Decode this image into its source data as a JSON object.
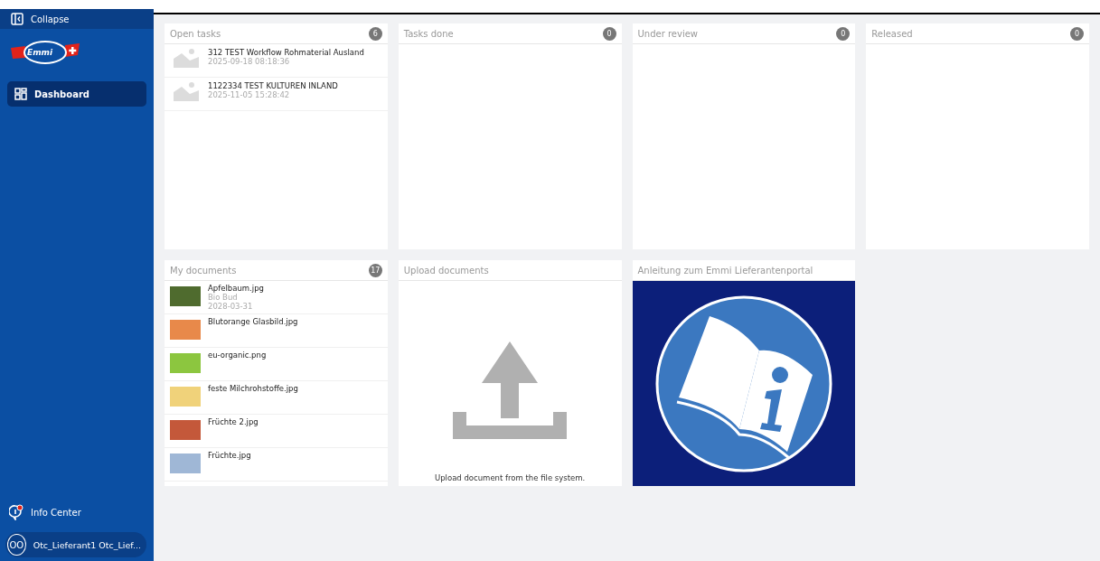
{
  "sidebar": {
    "collapse": "Collapse",
    "logo": "Emmi",
    "items": [
      {
        "label": "Dashboard",
        "selected": true
      }
    ],
    "info_center": {
      "label": "Info Center",
      "notification": true
    },
    "user": {
      "initials": "OO",
      "name": "Otc_Lieferant1 Otc_Lief..."
    }
  },
  "task_columns": [
    {
      "title": "Open tasks",
      "count": "6",
      "items": [
        {
          "title": "312 TEST Workflow Rohmaterial Ausland",
          "date": "2025-09-18 08:18:36"
        },
        {
          "title": "1122334 TEST KULTUREN INLAND",
          "date": "2025-11-05 15:28:42"
        }
      ]
    },
    {
      "title": "Tasks done",
      "count": "0"
    },
    {
      "title": "Under review",
      "count": "0"
    },
    {
      "title": "Released",
      "count": "0"
    }
  ],
  "my_documents": {
    "title": "My documents",
    "count": "17",
    "items": [
      {
        "name": "Apfelbaum.jpg",
        "tag": "Bio Bud",
        "date": "2028-03-31",
        "color": "#4f6b2e"
      },
      {
        "name": "Blutorange Glasbild.jpg",
        "color": "#e8894a"
      },
      {
        "name": "eu-organic.png",
        "color": "#8cc63f"
      },
      {
        "name": "feste Milchrohstoffe.jpg",
        "color": "#f0d27a"
      },
      {
        "name": "Früchte 2.jpg",
        "color": "#c4583a"
      },
      {
        "name": "Früchte.jpg",
        "color": "#9fb7d6"
      }
    ]
  },
  "upload": {
    "title": "Upload documents",
    "hint": "Upload document from the file system."
  },
  "guide": {
    "title": "Anleitung zum Emmi Lieferantenportal"
  }
}
